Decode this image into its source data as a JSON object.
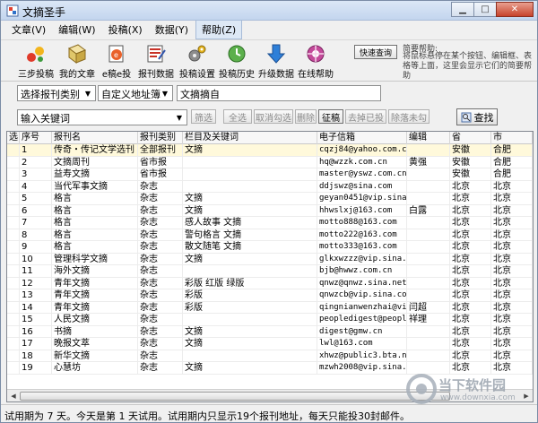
{
  "window": {
    "title": "文摘圣手"
  },
  "menu": [
    {
      "label": "文章(V)"
    },
    {
      "label": "编辑(W)"
    },
    {
      "label": "投稿(X)"
    },
    {
      "label": "数据(Y)"
    },
    {
      "label": "帮助(Z)"
    }
  ],
  "toolbar": {
    "tools": [
      {
        "label": "三步投稿",
        "icon": "steps-icon"
      },
      {
        "label": "我的文章",
        "icon": "my-articles-icon"
      },
      {
        "label": "e稿e投",
        "icon": "email-submit-icon"
      },
      {
        "label": "报刊数据",
        "icon": "journal-data-icon"
      },
      {
        "label": "投稿设置",
        "icon": "settings-icon"
      },
      {
        "label": "投稿历史",
        "icon": "history-icon"
      },
      {
        "label": "升级数据",
        "icon": "upgrade-icon"
      },
      {
        "label": "在线帮助",
        "icon": "online-help-icon"
      }
    ],
    "quick_query": "快速查询",
    "help_title": "简要帮助:",
    "help_text": "将鼠标悬停在某个按钮、编辑框、表格等上面，这里会显示它们的简要帮助"
  },
  "filters": {
    "category": "选择报刊类别",
    "address_book": "自定义地址簿",
    "tab_label": "文摘摘自",
    "keyword_placeholder": "输入关键词",
    "buttons": {
      "filter": "筛选",
      "select_all": "全选",
      "cancel_check": "取消勾选",
      "delete": "删除",
      "collect": "征稿",
      "remove_sent": "去掉已投",
      "exclude": "除落未勾",
      "search": "查找"
    }
  },
  "table": {
    "columns": [
      "选",
      "序号",
      "报刊名",
      "报刊类别",
      "栏目及关键词",
      "电子信箱",
      "编辑",
      "省",
      "市"
    ],
    "rows": [
      [
        "",
        "1",
        "传奇・传记文学选刊",
        "全部报刊",
        "文摘",
        "cqzj84@yahoo.com.cn",
        "",
        "安徽",
        "合肥"
      ],
      [
        "",
        "2",
        "文摘周刊",
        "省市报",
        "",
        "hq@wzzk.com.cn",
        "黄强",
        "安徽",
        "合肥"
      ],
      [
        "",
        "3",
        "益寿文摘",
        "省市报",
        "",
        "master@yswz.com.cn",
        "",
        "安徽",
        "合肥"
      ],
      [
        "",
        "4",
        "当代军事文摘",
        "杂志",
        "",
        "ddjswz@sina.com",
        "",
        "北京",
        "北京"
      ],
      [
        "",
        "5",
        "格言",
        "杂志",
        "文摘",
        "geyan0451@vip.sina.c",
        "",
        "北京",
        "北京"
      ],
      [
        "",
        "6",
        "格言",
        "杂志",
        "文摘",
        "hhwslxj@163.com",
        "白露",
        "北京",
        "北京"
      ],
      [
        "",
        "7",
        "格言",
        "杂志",
        "感人故事 文摘",
        "motto888@163.com",
        "",
        "北京",
        "北京"
      ],
      [
        "",
        "8",
        "格言",
        "杂志",
        "警句格言 文摘",
        "motto222@163.com",
        "",
        "北京",
        "北京"
      ],
      [
        "",
        "9",
        "格言",
        "杂志",
        "散文随笔 文摘",
        "motto333@163.com",
        "",
        "北京",
        "北京"
      ],
      [
        "",
        "10",
        "管理科学文摘",
        "杂志",
        "文摘",
        "glkxwzzz@vip.sina.com",
        "",
        "北京",
        "北京"
      ],
      [
        "",
        "11",
        "海外文摘",
        "杂志",
        "",
        "bjb@hwwz.com.cn",
        "",
        "北京",
        "北京"
      ],
      [
        "",
        "12",
        "青年文摘",
        "杂志",
        "彩版 红版 绿版",
        "qnwz@qnwz.sina.net",
        "",
        "北京",
        "北京"
      ],
      [
        "",
        "13",
        "青年文摘",
        "杂志",
        "彩版",
        "qnwzcb@vip.sina.com",
        "",
        "北京",
        "北京"
      ],
      [
        "",
        "14",
        "青年文摘",
        "杂志",
        "彩版",
        "qingnianwenzhai@vip.",
        "闫超",
        "北京",
        "北京"
      ],
      [
        "",
        "15",
        "人民文摘",
        "杂志",
        "",
        "peopledigest@people.",
        "祥理",
        "北京",
        "北京"
      ],
      [
        "",
        "16",
        "书摘",
        "杂志",
        "文摘",
        "digest@gmw.cn",
        "",
        "北京",
        "北京"
      ],
      [
        "",
        "17",
        "晚报文萃",
        "杂志",
        "文摘",
        "lwl@163.com",
        "",
        "北京",
        "北京"
      ],
      [
        "",
        "18",
        "新华文摘",
        "杂志",
        "",
        "xhwz@public3.bta.net",
        "",
        "北京",
        "北京"
      ],
      [
        "",
        "19",
        "心慧坊",
        "杂志",
        "文摘",
        "mzwh2008@vip.sina.com",
        "",
        "北京",
        "北京"
      ]
    ]
  },
  "status": {
    "text": "试用期为 7 天。今天是第 1 天试用。试用期内只显示19个报刊地址，每天只能投30封邮件。"
  },
  "watermark": {
    "cn": "当下软件园",
    "en": "www.downxia.com"
  }
}
